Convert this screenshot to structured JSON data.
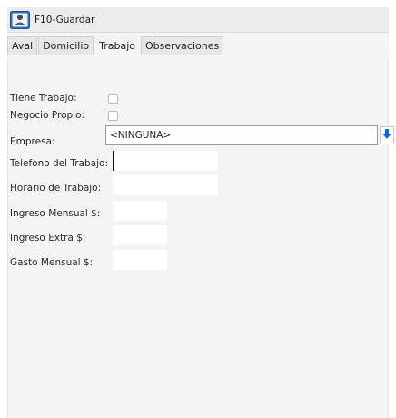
{
  "toolbar": {
    "save_label": "F10-Guardar",
    "save_icon": "save-person-icon"
  },
  "tabs": [
    {
      "label": "Aval",
      "active": false
    },
    {
      "label": "Domicilio",
      "active": false
    },
    {
      "label": "Trabajo",
      "active": true
    },
    {
      "label": "Observaciones",
      "active": false
    }
  ],
  "form": {
    "tiene_trabajo": {
      "label": "Tiene Trabajo:",
      "checked": false
    },
    "negocio_propio": {
      "label": "Negocio Propio:",
      "checked": false
    },
    "empresa": {
      "label": "Empresa:",
      "value": "<NINGUNA>",
      "button_icon": "arrow-down-icon"
    },
    "telefono": {
      "label": "Telefono del Trabajo:",
      "value": ""
    },
    "horario": {
      "label": "Horario de Trabajo:",
      "value": ""
    },
    "ingreso_mensual": {
      "label": "Ingreso Mensual $:",
      "value": ""
    },
    "ingreso_extra": {
      "label": "Ingreso Extra $:",
      "value": ""
    },
    "gasto_mensual": {
      "label": "Gasto Mensual $:",
      "value": ""
    }
  },
  "colors": {
    "window_bg": "#f4f4f4",
    "accent_blue": "#1565d8"
  }
}
